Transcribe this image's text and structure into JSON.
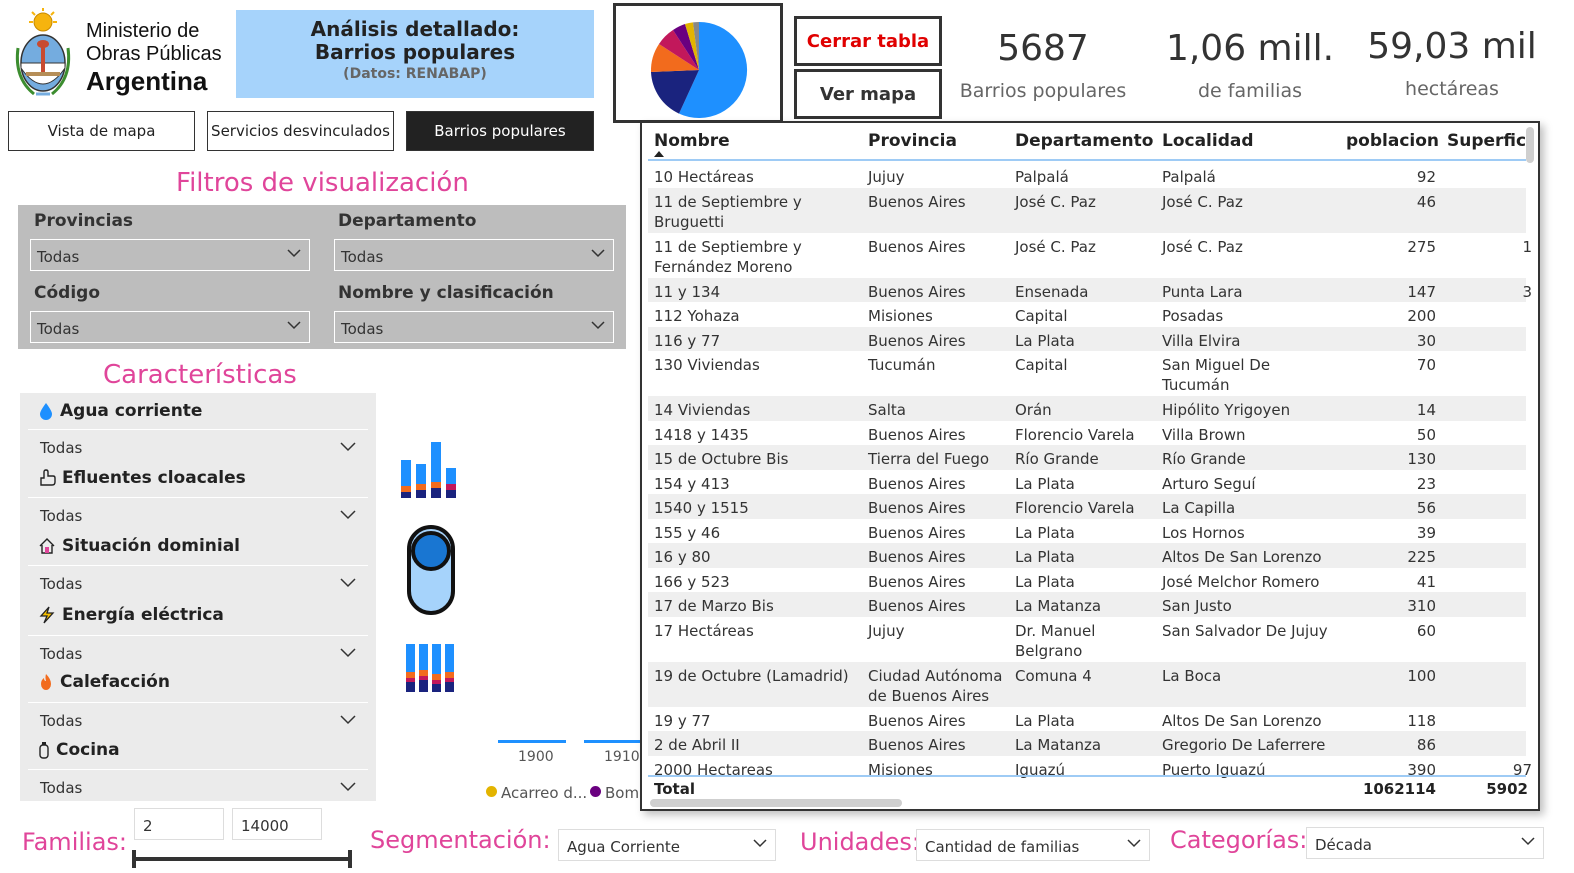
{
  "header": {
    "ministry_line1": "Ministerio de",
    "ministry_line2": "Obras Públicas",
    "ministry_line3": "Argentina",
    "title_line1": "Análisis detallado:",
    "title_line2": "Barrios populares",
    "source": "(Datos: RENABAP)"
  },
  "nav": {
    "tab1": "Vista de mapa",
    "tab2": "Servicios desvinculados",
    "tab3": "Barrios populares"
  },
  "filters": {
    "title": "Filtros de visualización",
    "provincias_label": "Provincias",
    "provincias_value": "Todas",
    "departamento_label": "Departamento",
    "departamento_value": "Todas",
    "codigo_label": "Código",
    "codigo_value": "Todas",
    "nombre_label": "Nombre y clasificación",
    "nombre_value": "Todas"
  },
  "caracteristicas": {
    "title": "Características",
    "items": [
      {
        "label": "Agua corriente",
        "value": "Todas",
        "icon": "water-drop-icon"
      },
      {
        "label": "Efluentes cloacales",
        "value": "Todas",
        "icon": "hand-icon"
      },
      {
        "label": "Situación dominial",
        "value": "Todas",
        "icon": "house-icon"
      },
      {
        "label": "Energía eléctrica",
        "value": "Todas",
        "icon": "bolt-icon"
      },
      {
        "label": "Calefacción",
        "value": "Todas",
        "icon": "fire-icon"
      },
      {
        "label": "Cocina",
        "value": "Todas",
        "icon": "gas-cylinder-icon"
      }
    ]
  },
  "buttons": {
    "cerrar_tabla": "Cerrar tabla",
    "ver_mapa": "Ver mapa"
  },
  "kpis": [
    {
      "value": "5687",
      "label": "Barrios populares"
    },
    {
      "value": "1,06 mill.",
      "label": "de familias"
    },
    {
      "value": "59,03 mil",
      "label": "hectáreas"
    }
  ],
  "background_chart": {
    "axis_ticks": [
      "1900",
      "1910"
    ],
    "legend": [
      "Acarreo d...",
      "Bom"
    ],
    "legend_colors": [
      "#e3b400",
      "#6a0080"
    ]
  },
  "table": {
    "headers": [
      "Nombre",
      "Provincia",
      "Departamento",
      "Localidad",
      "poblacion",
      "Superfici"
    ],
    "rows": [
      {
        "nombre": "10 Hectáreas",
        "provincia": "Jujuy",
        "departamento": "Palpalá",
        "localidad": "Palpalá",
        "poblacion": "92",
        "superficie": ""
      },
      {
        "nombre": "11 de Septiembre y Bruguetti",
        "provincia": "Buenos Aires",
        "departamento": "José C. Paz",
        "localidad": "José C. Paz",
        "poblacion": "46",
        "superficie": ""
      },
      {
        "nombre": "11 de Septiembre y Fernández Moreno",
        "provincia": "Buenos Aires",
        "departamento": "José C. Paz",
        "localidad": "José C. Paz",
        "poblacion": "275",
        "superficie": "1"
      },
      {
        "nombre": "11 y 134",
        "provincia": "Buenos Aires",
        "departamento": "Ensenada",
        "localidad": "Punta Lara",
        "poblacion": "147",
        "superficie": "3"
      },
      {
        "nombre": "112 Yohaza",
        "provincia": "Misiones",
        "departamento": "Capital",
        "localidad": "Posadas",
        "poblacion": "200",
        "superficie": ""
      },
      {
        "nombre": "116 y 77",
        "provincia": "Buenos Aires",
        "departamento": "La Plata",
        "localidad": "Villa Elvira",
        "poblacion": "30",
        "superficie": ""
      },
      {
        "nombre": "130 Viviendas",
        "provincia": "Tucumán",
        "departamento": "Capital",
        "localidad": "San Miguel De Tucumán",
        "poblacion": "70",
        "superficie": ""
      },
      {
        "nombre": "14 Viviendas",
        "provincia": "Salta",
        "departamento": "Orán",
        "localidad": "Hipólito Yrigoyen",
        "poblacion": "14",
        "superficie": ""
      },
      {
        "nombre": "1418 y 1435",
        "provincia": "Buenos Aires",
        "departamento": "Florencio Varela",
        "localidad": "Villa Brown",
        "poblacion": "50",
        "superficie": ""
      },
      {
        "nombre": "15 de Octubre Bis",
        "provincia": "Tierra del Fuego",
        "departamento": "Río Grande",
        "localidad": "Río Grande",
        "poblacion": "130",
        "superficie": ""
      },
      {
        "nombre": "154 y 413",
        "provincia": "Buenos Aires",
        "departamento": "La Plata",
        "localidad": "Arturo Seguí",
        "poblacion": "23",
        "superficie": ""
      },
      {
        "nombre": "1540 y 1515",
        "provincia": "Buenos Aires",
        "departamento": "Florencio Varela",
        "localidad": "La Capilla",
        "poblacion": "56",
        "superficie": ""
      },
      {
        "nombre": "155 y 46",
        "provincia": "Buenos Aires",
        "departamento": "La Plata",
        "localidad": "Los Hornos",
        "poblacion": "39",
        "superficie": ""
      },
      {
        "nombre": "16 y 80",
        "provincia": "Buenos Aires",
        "departamento": "La Plata",
        "localidad": "Altos De San Lorenzo",
        "poblacion": "225",
        "superficie": ""
      },
      {
        "nombre": "166 y 523",
        "provincia": "Buenos Aires",
        "departamento": "La Plata",
        "localidad": "José Melchor Romero",
        "poblacion": "41",
        "superficie": ""
      },
      {
        "nombre": "17 de Marzo Bis",
        "provincia": "Buenos Aires",
        "departamento": "La Matanza",
        "localidad": "San Justo",
        "poblacion": "310",
        "superficie": ""
      },
      {
        "nombre": "17 Hectáreas",
        "provincia": "Jujuy",
        "departamento": "Dr. Manuel Belgrano",
        "localidad": "San Salvador De Jujuy",
        "poblacion": "60",
        "superficie": ""
      },
      {
        "nombre": "19 de Octubre (Lamadrid)",
        "provincia": "Ciudad Autónoma de Buenos Aires",
        "departamento": "Comuna 4",
        "localidad": "La Boca",
        "poblacion": "100",
        "superficie": ""
      },
      {
        "nombre": "19 y 77",
        "provincia": "Buenos Aires",
        "departamento": "La Plata",
        "localidad": "Altos De San Lorenzo",
        "poblacion": "118",
        "superficie": ""
      },
      {
        "nombre": "2 de Abril II",
        "provincia": "Buenos Aires",
        "departamento": "La Matanza",
        "localidad": "Gregorio De Laferrere",
        "poblacion": "86",
        "superficie": ""
      },
      {
        "nombre": "2000 Hectareas",
        "provincia": "Misiones",
        "departamento": "Iguazú",
        "localidad": "Puerto Iguazú",
        "poblacion": "390",
        "superficie": "97"
      }
    ],
    "total_label": "Total",
    "total_poblacion": "1062114",
    "total_superficie": "5902"
  },
  "bottom": {
    "familias_label": "Familias:",
    "familias_min": "2",
    "familias_max": "14000",
    "segmentacion_label": "Segmentación:",
    "segmentacion_value": "Agua Corriente",
    "unidades_label": "Unidades:",
    "unidades_value": "Cantidad de familias",
    "categorias_label": "Categorías:",
    "categorias_value": "Década"
  }
}
